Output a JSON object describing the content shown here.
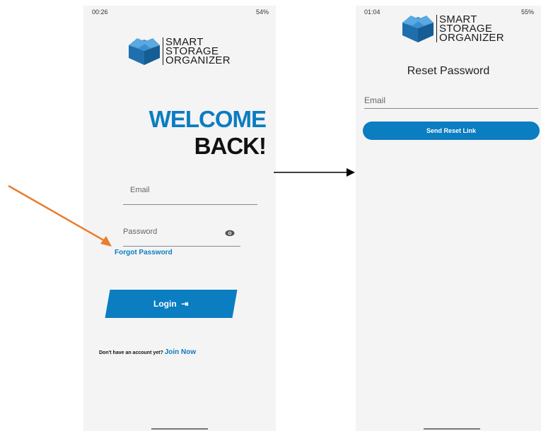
{
  "left_screen": {
    "status_time": "00:26",
    "status_right": "54%",
    "logo": [
      "SMART",
      "STORAGE",
      "ORGANIZER"
    ],
    "welcome": "WELCOME",
    "back": "BACK!",
    "email_placeholder": "Email",
    "password_placeholder": "Password",
    "forgot_password": "Forgot Password",
    "login_label": "Login",
    "signup_prompt": "Don't have an account yet?",
    "signup_link": "Join Now"
  },
  "right_screen": {
    "status_time": "01:04",
    "status_right": "55%",
    "logo": [
      "SMART",
      "STORAGE",
      "ORGANIZER"
    ],
    "title": "Reset Password",
    "email_placeholder": "Email",
    "send_button": "Send Reset Link"
  },
  "colors": {
    "brand_blue": "#0b7dc1",
    "arrow_orange": "#e87e2f"
  }
}
